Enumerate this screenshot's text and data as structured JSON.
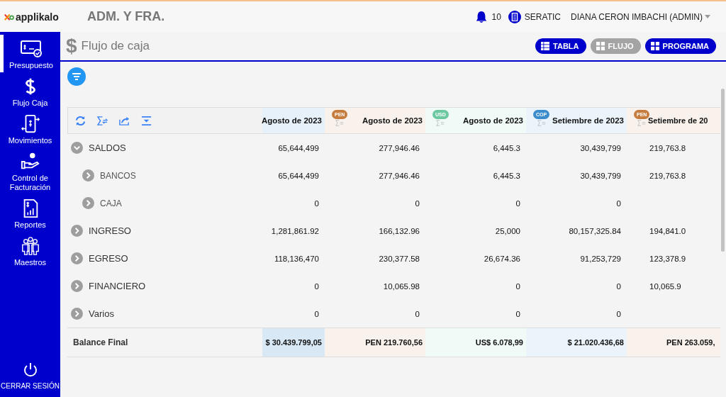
{
  "brand": {
    "name": "applikalo"
  },
  "company": "ADM. Y FRA.",
  "notifications": "10",
  "org": "SERATIC",
  "user": "DIANA CERON IMBACHI (ADMIN)",
  "sidebar": {
    "items": [
      {
        "label": "Presupuesto",
        "kind": "budget",
        "selected": true
      },
      {
        "label": "Flujo Caja",
        "kind": "dollar",
        "selected": false
      },
      {
        "label": "Movimientos",
        "kind": "phone",
        "selected": false
      },
      {
        "label": "Control de Facturación",
        "kind": "hand",
        "selected": false
      },
      {
        "label": "Reportes",
        "kind": "report",
        "selected": false
      },
      {
        "label": "Maestros",
        "kind": "people",
        "selected": false
      }
    ],
    "logout": "CERRAR SESIÓN"
  },
  "page": {
    "icon": "$",
    "title": "Flujo de caja"
  },
  "view_buttons": [
    {
      "label": "TABLA",
      "disabled": false
    },
    {
      "label": "FLUJO",
      "disabled": true
    },
    {
      "label": "PROGRAMA",
      "disabled": false
    }
  ],
  "table": {
    "columns": [
      {
        "label": "Agosto de 2023"
      },
      {
        "label": "Agosto de 2023",
        "badge": "PEN",
        "color": "#c67c3e"
      },
      {
        "label": "Agosto de 2023",
        "badge": "USD",
        "color": "#6cc8a0"
      },
      {
        "label": "Setiembre de 2023",
        "badge": "COP",
        "color": "#3b8ccc"
      },
      {
        "label": "Setiembre de 20",
        "badge": "PEN",
        "color": "#c67c3e"
      }
    ],
    "rows": [
      {
        "label": "SALDOS",
        "expanded": true,
        "values": [
          "65,644,499",
          "277,946.46",
          "6,445.3",
          "30,439,799",
          "219,763.8"
        ],
        "children": [
          {
            "label": "BANCOS",
            "expanded": false,
            "values": [
              "65,644,499",
              "277,946.46",
              "6,445.3",
              "30,439,799",
              "219,763.8"
            ]
          },
          {
            "label": "CAJA",
            "expanded": false,
            "values": [
              "0",
              "0",
              "0",
              "0"
            ]
          }
        ]
      },
      {
        "label": "INGRESO",
        "expanded": false,
        "values": [
          "1,281,861.92",
          "166,132.96",
          "25,000",
          "80,157,325.84",
          "194,841.0"
        ]
      },
      {
        "label": "EGRESO",
        "expanded": false,
        "values": [
          "118,136,470",
          "230,377.58",
          "26,674.36",
          "91,253,729",
          "123,378.9"
        ]
      },
      {
        "label": "FINANCIERO",
        "expanded": false,
        "values": [
          "0",
          "10,065.98",
          "0",
          "0",
          "10,065.9"
        ]
      },
      {
        "label": "Varios",
        "expanded": false,
        "values": [
          "0",
          "0",
          "0",
          "0"
        ]
      }
    ],
    "footer": {
      "label": "Balance Final",
      "values": [
        "$ 30.439.799,05",
        "PEN 219.760,56",
        "US$ 6.078,99",
        "$ 21.020.436,68",
        "PEN 263.059,"
      ]
    }
  }
}
